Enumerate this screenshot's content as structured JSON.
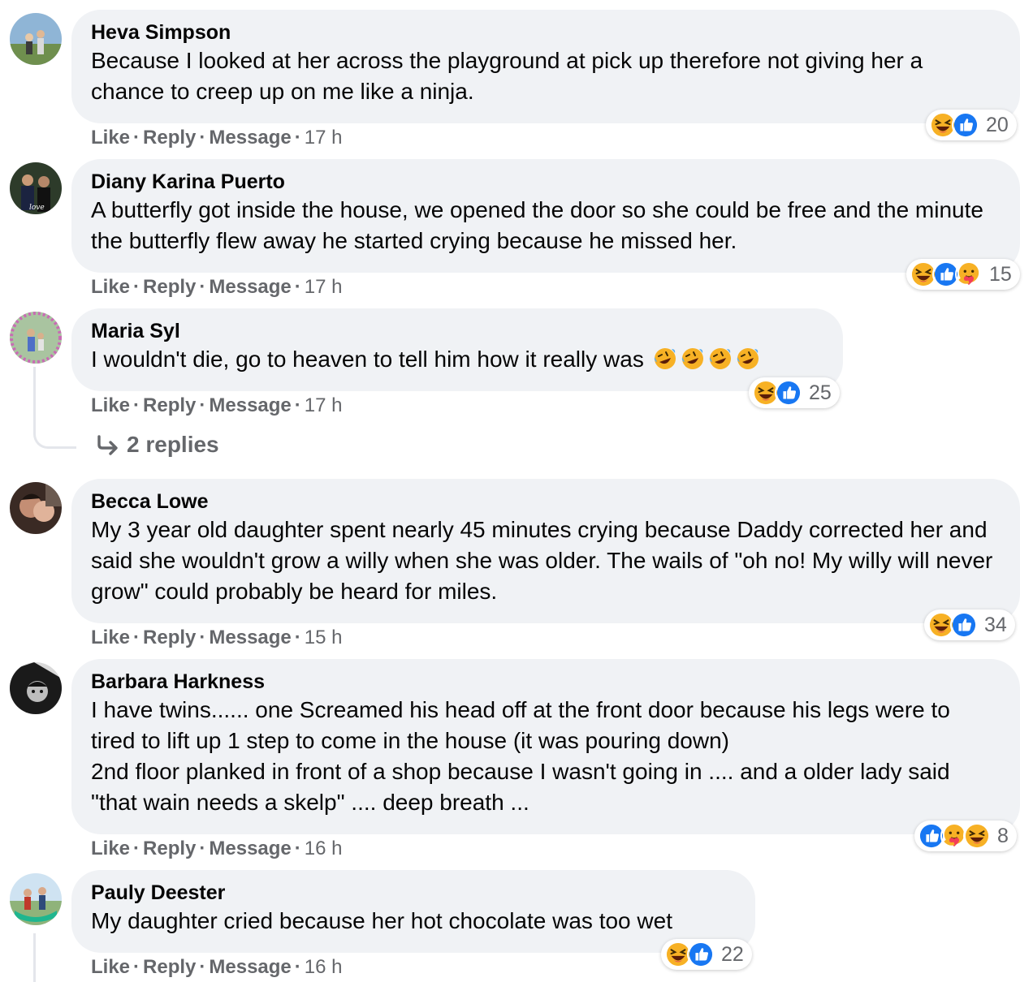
{
  "comments": [
    {
      "author": "Heva Simpson",
      "text": "Because I looked at her across the playground at pick up therefore not giving her a chance to creep up on me like a ninja.",
      "like": "Like",
      "reply": "Reply",
      "message": "Message",
      "time": "17 h",
      "reactions": [
        "laugh",
        "like"
      ],
      "count": "20"
    },
    {
      "author": "Diany Karina Puerto",
      "text": "A butterfly got inside the house, we opened the door so she could be free and the minute the butterfly flew away he started crying because he missed her.",
      "like": "Like",
      "reply": "Reply",
      "message": "Message",
      "time": "17 h",
      "reactions": [
        "laugh",
        "like",
        "care"
      ],
      "count": "15"
    },
    {
      "author": "Maria Syl",
      "text": "I wouldn't die, go to heaven to tell him how it really was",
      "like": "Like",
      "reply": "Reply",
      "message": "Message",
      "time": "17 h",
      "reactions": [
        "laugh",
        "like"
      ],
      "count": "25",
      "replies_label": "2 replies"
    },
    {
      "author": "Becca Lowe",
      "text": "My 3 year old daughter spent nearly 45 minutes crying because Daddy corrected her and said she wouldn't grow a willy when she was older. The wails of \"oh no! My willy will never grow\" could probably be heard for miles.",
      "like": "Like",
      "reply": "Reply",
      "message": "Message",
      "time": "15 h",
      "reactions": [
        "laugh",
        "like"
      ],
      "count": "34"
    },
    {
      "author": "Barbara Harkness",
      "text": "I have twins...... one Screamed his head off at the front door because his legs were to tired to lift up 1 step to come in the house (it was pouring down)\n2nd floor planked in front of a shop because I wasn't going in .... and a older lady said \"that wain needs a skelp\" .... deep breath ...",
      "like": "Like",
      "reply": "Reply",
      "message": "Message",
      "time": "16 h",
      "reactions": [
        "like",
        "care",
        "laugh"
      ],
      "count": "8"
    },
    {
      "author": "Pauly Deester",
      "text": "My daughter cried because her hot chocolate was too wet",
      "like": "Like",
      "reply": "Reply",
      "message": "Message",
      "time": "16 h",
      "reactions": [
        "laugh",
        "like"
      ],
      "count": "22"
    }
  ],
  "colors": {
    "bubble": "#f0f2f5",
    "meta": "#65676b",
    "like_blue": "#1877f2",
    "laugh_yellow": "#f7b125"
  }
}
